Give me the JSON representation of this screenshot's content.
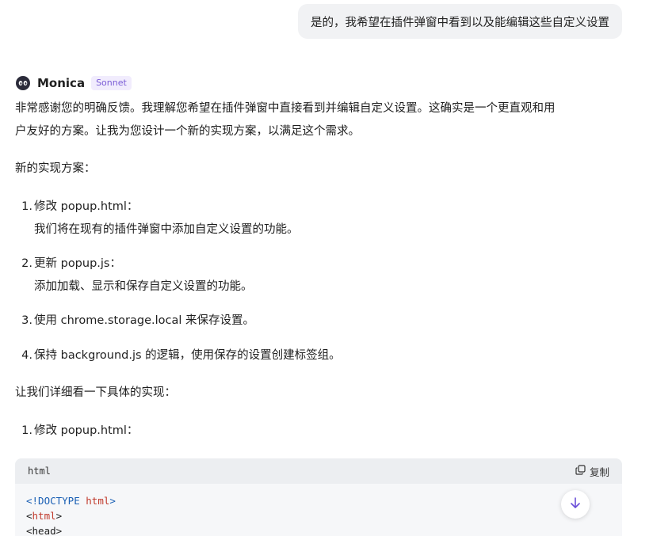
{
  "user_message": "是的，我希望在插件弹窗中看到以及能编辑这些自定义设置",
  "assistant": {
    "name": "Monica",
    "model": "Sonnet",
    "paragraph1_line1": "非常感谢您的明确反馈。我理解您希望在插件弹窗中直接看到并编辑自定义设置。这确实是一个更直观和用",
    "paragraph1_line2": "户友好的方案。让我为您设计一个新的实现方案，以满足这个需求。",
    "section_heading": "新的实现方案：",
    "plan_items": [
      {
        "num": "1.",
        "title": "修改 popup.html：",
        "desc": "我们将在现有的插件弹窗中添加自定义设置的功能。"
      },
      {
        "num": "2.",
        "title": "更新 popup.js：",
        "desc": "添加加载、显示和保存自定义设置的功能。"
      },
      {
        "num": "3.",
        "title": "使用 chrome.storage.local 来保存设置。",
        "desc": ""
      },
      {
        "num": "4.",
        "title": "保持 background.js 的逻辑，使用保存的设置创建标签组。",
        "desc": ""
      }
    ],
    "detail_heading": "让我们详细看一下具体的实现：",
    "detail_items": [
      {
        "num": "1.",
        "title": "修改 popup.html："
      }
    ]
  },
  "code_block": {
    "language": "html",
    "copy_label": "复制",
    "line1_open": "<!DOCTYPE ",
    "line1_word": "html",
    "line1_close": ">",
    "line2_open": "<",
    "line2_word": "html",
    "line2_close": ">",
    "line3": "<head>"
  },
  "colors": {
    "accent": "#7a5cd6",
    "scroll_arrow": "#6b4fd8"
  },
  "icons": {
    "avatar": "monica-bot-icon",
    "copy": "copy-icon",
    "scroll": "arrow-down-icon"
  }
}
